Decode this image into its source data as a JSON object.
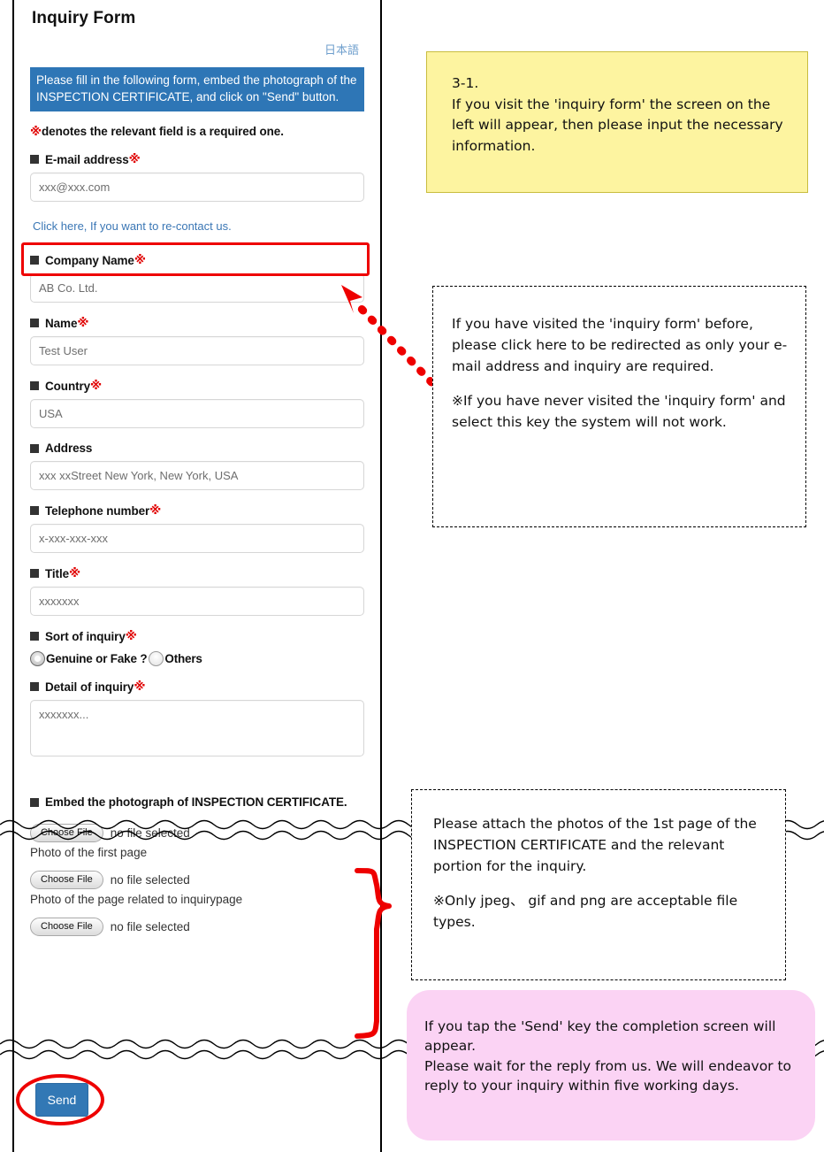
{
  "form": {
    "title": "Inquiry Form",
    "language_link": "日本語",
    "intro_banner": "Please fill in the following form, embed the photograph of the INSPECTION CERTIFICATE, and click on \"Send\" button.",
    "required_mark": "※",
    "required_note": "denotes the relevant field is a required one.",
    "fields": {
      "email": {
        "label": "E-mail address",
        "placeholder": "xxx@xxx.com"
      },
      "recontact_link": "Click here, If you want to re-contact us.",
      "company": {
        "label": "Company Name",
        "placeholder": "AB Co. Ltd."
      },
      "name": {
        "label": "Name",
        "placeholder": "Test User"
      },
      "country": {
        "label": "Country",
        "placeholder": "USA"
      },
      "address": {
        "label": "Address",
        "placeholder": "xxx xxStreet New York, New York, USA"
      },
      "telephone": {
        "label": "Telephone number",
        "placeholder": "x-xxx-xxx-xxx"
      },
      "title_field": {
        "label": "Title",
        "placeholder": "xxxxxxx"
      },
      "sort_of_inquiry": {
        "label": "Sort of inquiry",
        "options": [
          "Genuine or Fake ?",
          "Others"
        ],
        "selected": "Genuine or Fake ?"
      },
      "detail": {
        "label": "Detail of inquiry",
        "placeholder": "xxxxxxx..."
      },
      "embed_photo": {
        "label": "Embed the photograph of INSPECTION CERTIFICATE.",
        "rows": [
          {
            "button": "Choose File",
            "status": "no file selected",
            "caption": "Photo of the first page"
          },
          {
            "button": "Choose File",
            "status": "no file selected",
            "caption": "Photo of the page related to inquirypage"
          },
          {
            "button": "Choose File",
            "status": "no file selected",
            "caption": ""
          }
        ]
      }
    },
    "send_button": "Send"
  },
  "annotations": {
    "yellow": {
      "step": "3-1.",
      "body": "If you visit the 'inquiry form' the screen on the left will appear, then please input the necessary information."
    },
    "recontact": {
      "paragraph1": "If you have visited the 'inquiry form' before, please click here to be redirected as only your e-mail address and inquiry are required.",
      "paragraph2": "※If you have never visited the 'inquiry form' and select this key the system will not work."
    },
    "photos": {
      "paragraph1": "Please attach the photos of the 1st page of the INSPECTION CERTIFICATE and the relevant portion for the inquiry.",
      "paragraph2": "※Only jpeg、 gif and png are acceptable file types."
    },
    "send": {
      "paragraph1": "If you tap the 'Send' key the completion screen will appear.",
      "paragraph2": "Please wait for the reply from us. We will endeavor to reply to your inquiry within five working days."
    }
  },
  "colors": {
    "banner_blue": "#2e76b6",
    "send_blue": "#3278b5",
    "highlight_red": "#ee0000",
    "required_red": "#e00000",
    "callout_yellow": "#fdf4a0",
    "callout_pink": "#fbd3f4",
    "link_blue": "#3b77b5"
  }
}
